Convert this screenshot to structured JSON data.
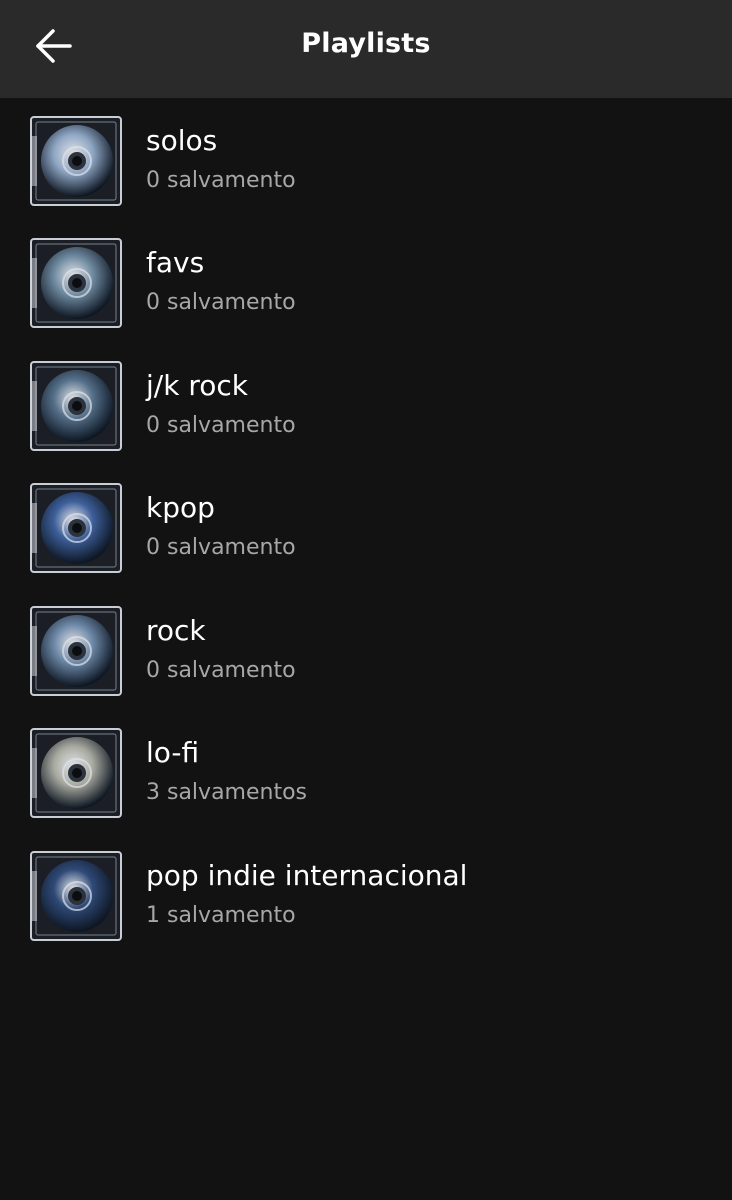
{
  "header": {
    "title": "Playlists",
    "back_icon": "arrow-left-icon"
  },
  "playlists": [
    {
      "name": "solos",
      "count": "0 salvamento",
      "cover_color": "#8fa6c4"
    },
    {
      "name": "favs",
      "count": "0 salvamento",
      "cover_color": "#6f8aa0"
    },
    {
      "name": "j/k rock",
      "count": "0 salvamento",
      "cover_color": "#55708a"
    },
    {
      "name": "kpop",
      "count": "0 salvamento",
      "cover_color": "#3d5f9a"
    },
    {
      "name": "rock",
      "count": "0 salvamento",
      "cover_color": "#6c87a6"
    },
    {
      "name": "lo-fi",
      "count": "3 salvamentos",
      "cover_color": "#a8aaa0"
    },
    {
      "name": "pop indie internacional",
      "count": "1 salvamento",
      "cover_color": "#2f4a78"
    }
  ],
  "colors": {
    "background": "#121212",
    "header": "#2a2a2a",
    "primary_text": "#ffffff",
    "secondary_text": "#a7a7a7"
  }
}
